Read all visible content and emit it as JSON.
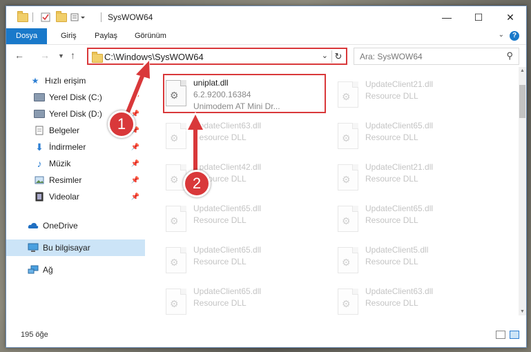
{
  "window": {
    "title": "SysWOW64",
    "controls": {
      "minimize": "—",
      "maximize": "☐",
      "close": "✕"
    }
  },
  "ribbon": {
    "tabs": [
      "Dosya",
      "Giriş",
      "Paylaş",
      "Görünüm"
    ]
  },
  "address": {
    "path": "C:\\Windows\\SysWOW64",
    "search_placeholder": "Ara: SysWOW64"
  },
  "nav": {
    "items": [
      {
        "label": "Hızlı erişim",
        "icon": "star-icon",
        "pinned": false
      },
      {
        "label": "Yerel Disk (C:)",
        "icon": "drive-icon",
        "pinned": true
      },
      {
        "label": "Yerel Disk (D:)",
        "icon": "drive-icon",
        "pinned": true
      },
      {
        "label": "Belgeler",
        "icon": "documents-icon",
        "pinned": true
      },
      {
        "label": "İndirmeler",
        "icon": "download-icon",
        "pinned": true
      },
      {
        "label": "Müzik",
        "icon": "music-icon",
        "pinned": true
      },
      {
        "label": "Resimler",
        "icon": "pictures-icon",
        "pinned": true
      },
      {
        "label": "Videolar",
        "icon": "video-icon",
        "pinned": true
      },
      {
        "label": "OneDrive",
        "icon": "cloud-icon",
        "pinned": false
      },
      {
        "label": "Bu bilgisayar",
        "icon": "computer-icon",
        "pinned": false,
        "selected": true
      },
      {
        "label": "Ağ",
        "icon": "network-icon",
        "pinned": false
      }
    ]
  },
  "files": {
    "highlighted": {
      "name": "uniplat.dll",
      "version": "6.2.9200.16384",
      "description": "Unimodem AT Mini Dr..."
    },
    "column1": [
      {
        "name": "UpdateClient63.dll",
        "type": "Resource DLL"
      },
      {
        "name": "UpdateClient42.dll",
        "type": "Resource DLL"
      },
      {
        "name": "UpdateClient65.dll",
        "type": "Resource DLL"
      },
      {
        "name": "UpdateClient65.dll",
        "type": "Resource DLL"
      },
      {
        "name": "UpdateClient65.dll",
        "type": "Resource DLL"
      }
    ],
    "column2": [
      {
        "name": "UpdateClient21.dll",
        "type": "Resource DLL"
      },
      {
        "name": "UpdateClient65.dll",
        "type": "Resource DLL"
      },
      {
        "name": "UpdateClient21.dll",
        "type": "Resource DLL"
      },
      {
        "name": "UpdateClient65.dll",
        "type": "Resource DLL"
      },
      {
        "name": "UpdateClient5.dll",
        "type": "Resource DLL"
      },
      {
        "name": "UpdateClient63.dll",
        "type": "Resource DLL"
      }
    ]
  },
  "status": {
    "item_count": "195 öğe"
  },
  "annotations": {
    "badge1": "1",
    "badge2": "2"
  },
  "colors": {
    "accent": "#1979ca",
    "highlight_red": "#d9383a"
  }
}
